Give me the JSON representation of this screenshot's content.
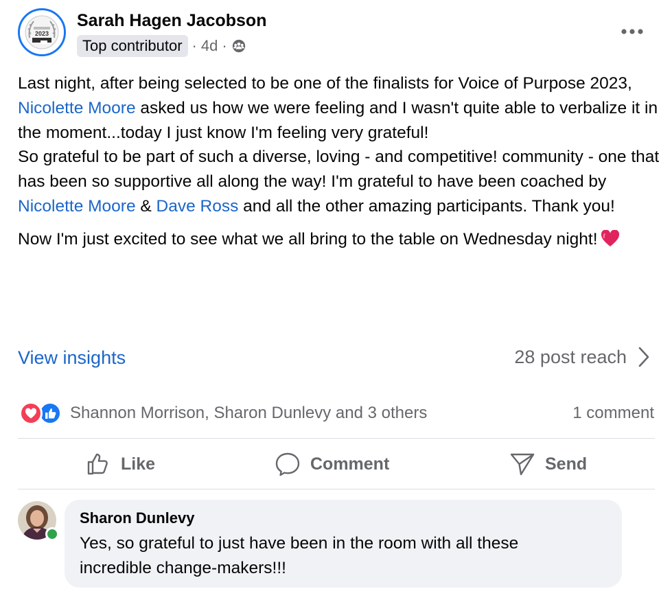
{
  "post": {
    "author": "Sarah Hagen Jacobson",
    "badge": "Top contributor",
    "separator_1": "·",
    "timestamp": "4d",
    "separator_2": "·",
    "audience_icon": "friends-group-icon",
    "avatar_badge_text": "2023",
    "more_icon": "more-horizontal-icon",
    "body": {
      "p1_t1": "Last night, after being selected to be one of the finalists for Voice of Purpose 2023, ",
      "p1_m1": "Nicolette Moore",
      "p1_t2": " asked us how we were feeling and I wasn't quite able to verbalize it in the moment...today I just know I'm feeling very grateful!",
      "p1_t3": "So grateful to be part of such a diverse, loving - and competitive! community - one that has been so supportive all along the way! I'm grateful to have been coached by ",
      "p1_m2": "Nicolette Moore",
      "p1_t4": " & ",
      "p1_m3": "Dave Ross",
      "p1_t5": " and all the other amazing participants. Thank you!",
      "p2_t1": "Now I'm just excited to see what we all bring to the table on Wednesday night!",
      "p2_emoji": "red-heart-emoji"
    }
  },
  "insights": {
    "view_label": "View insights",
    "reach_label": "28 post reach",
    "chevron_icon": "chevron-right-icon"
  },
  "reactions": {
    "icons": [
      "love-reaction-icon",
      "like-reaction-icon"
    ],
    "summary": "Shannon Morrison, Sharon Dunlevy and 3 others",
    "comment_count": "1 comment"
  },
  "actions": [
    {
      "label": "Like",
      "icon": "thumbs-up-icon"
    },
    {
      "label": "Comment",
      "icon": "speech-bubble-icon"
    },
    {
      "label": "Send",
      "icon": "send-icon"
    }
  ],
  "comment": {
    "author": "Sharon Dunlevy",
    "text_line_1": "Yes, so grateful to just have been in the room with all these",
    "text_line_2": "incredible change-makers!!!",
    "online_status": "online"
  },
  "colors": {
    "link": "#1b66c9",
    "secondary_text": "#65676b",
    "primary_text": "#050505",
    "love": "#f33e58",
    "like": "#1877f2",
    "online": "#31a24c",
    "bubble_bg": "#f0f2f5"
  }
}
